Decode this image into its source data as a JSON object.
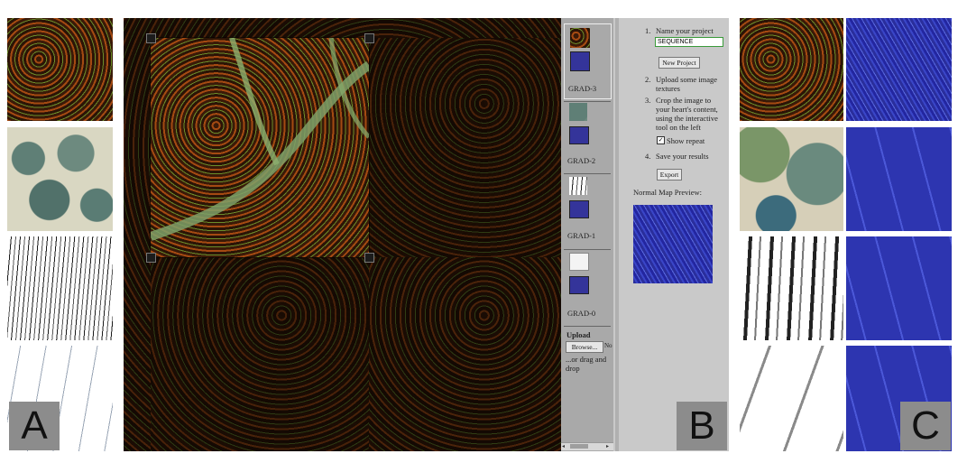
{
  "labels": {
    "a": "A",
    "b": "B",
    "c": "C"
  },
  "layers": [
    {
      "label": "GRAD-3",
      "selected": true
    },
    {
      "label": "GRAD-2",
      "selected": false
    },
    {
      "label": "GRAD-1",
      "selected": false
    },
    {
      "label": "GRAD-0",
      "selected": false
    }
  ],
  "upload": {
    "title": "Upload",
    "browse_label": "Browse...",
    "browse_suffix": "No",
    "drag_text": "...or drag and drop"
  },
  "steps": {
    "step1_num": "1.",
    "step1_text": "Name your project",
    "project_name_value": "SEQUENCE",
    "new_project_label": "New Project",
    "step2_num": "2.",
    "step2_text": "Upload some image textures",
    "step3_num": "3.",
    "step3_text": "Crop the image to your heart's content, using the interactive tool on the left",
    "show_repeat_label": "Show repeat",
    "show_repeat_checked": true,
    "step4_num": "4.",
    "step4_text": "Save your results",
    "export_label": "Export",
    "preview_title": "Normal Map Preview:"
  },
  "colors": {
    "panel_bg": "#c9c9c9",
    "layer_bg": "#a9a9a9",
    "normal_blue": "#2b31a8",
    "label_bg": "#8c8c8c"
  }
}
